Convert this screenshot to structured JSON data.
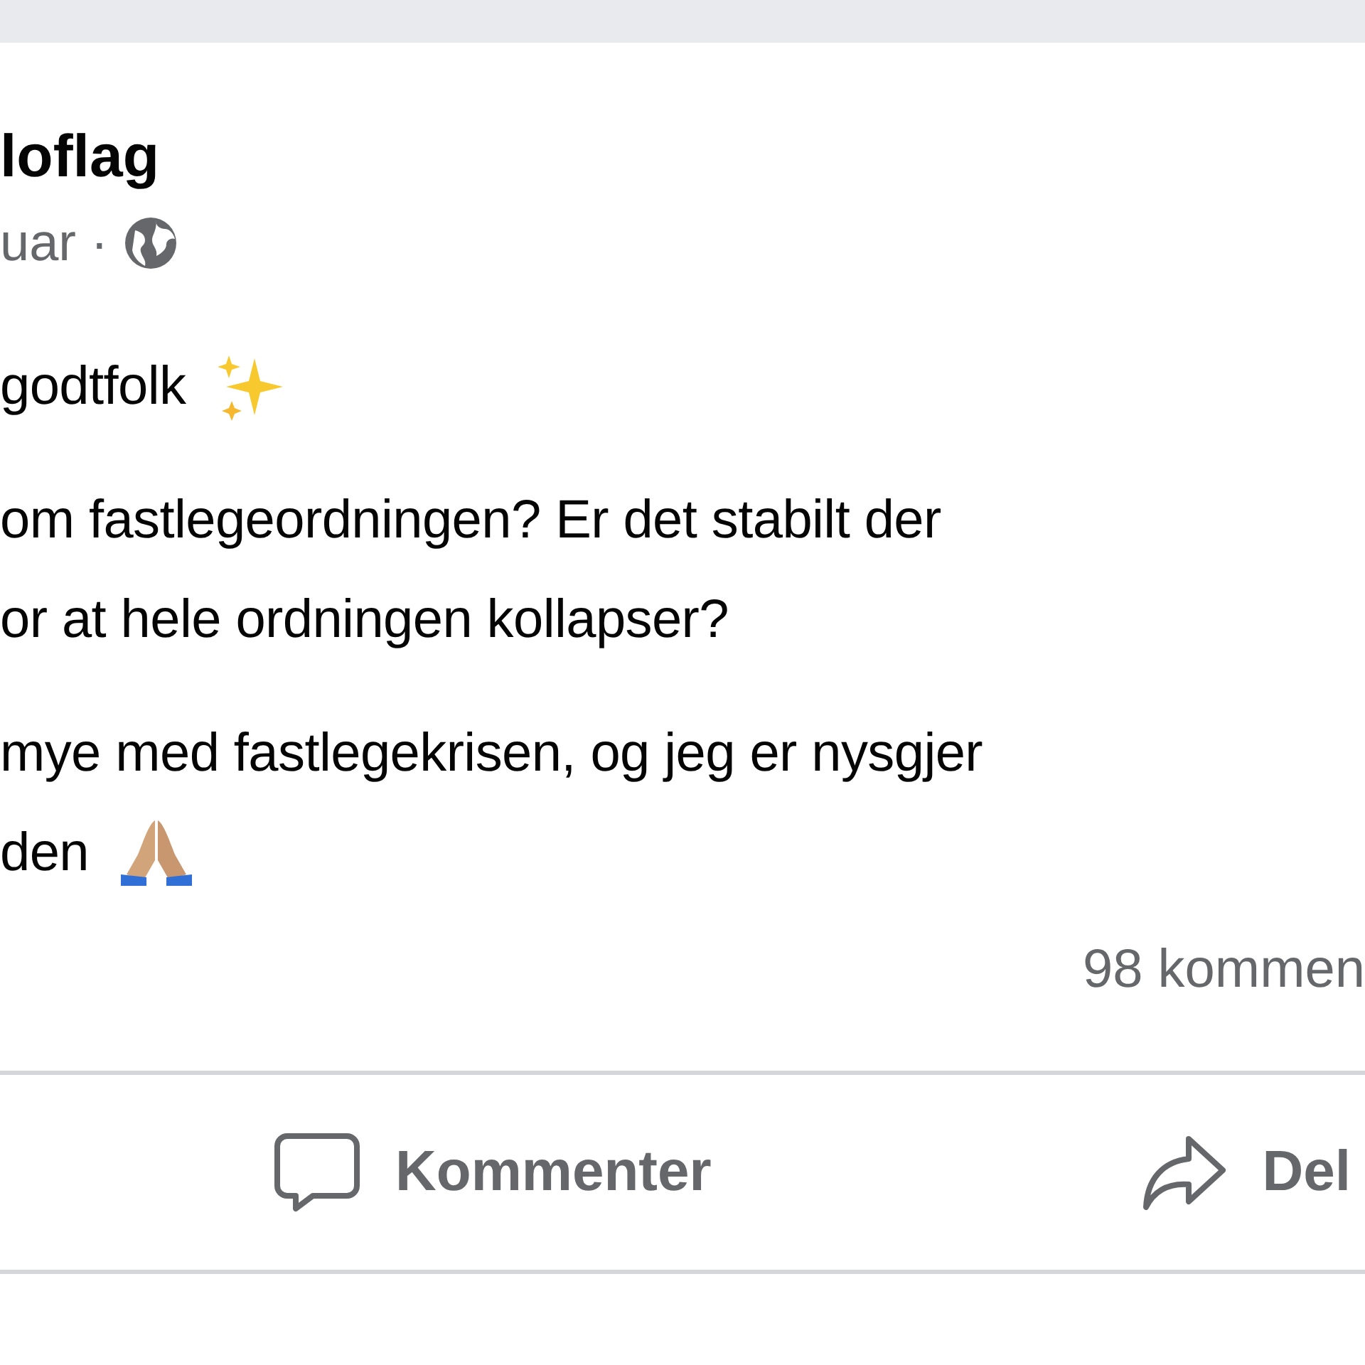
{
  "post": {
    "author": "loflag",
    "time": "uar ·",
    "paragraphs": [
      {
        "lines": [
          "godtfolk"
        ]
      },
      {
        "lines": [
          "om fastlegeordningen? Er det stabilt der",
          "or at hele ordningen kollapser?"
        ]
      },
      {
        "lines": [
          "mye med fastlegekrisen, og jeg er nysgjer",
          "den"
        ]
      }
    ],
    "comment_count": "98 kommen",
    "actions": [
      {
        "label": "Kommenter"
      },
      {
        "label": "Del"
      }
    ]
  }
}
